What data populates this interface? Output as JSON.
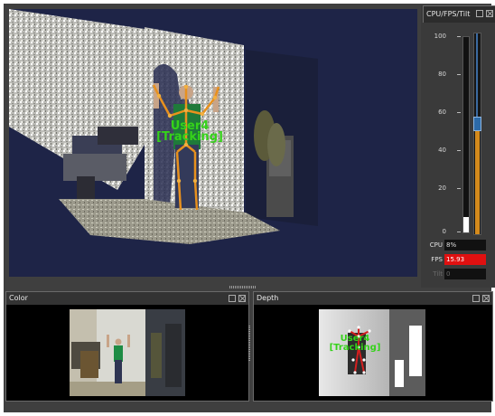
{
  "viewport": {
    "user_label": "User4",
    "tracking_label": "[Tracking]"
  },
  "side_panel": {
    "tab_title": "CPU/FPS/Tilt",
    "scale_ticks": [
      "100",
      "80",
      "60",
      "40",
      "20",
      "0"
    ],
    "cpu_bar_level": 0.08,
    "tilt_level": 0.55,
    "stats": [
      {
        "label": "CPU",
        "value": "8%"
      },
      {
        "label": "FPS",
        "value": "15.93"
      },
      {
        "label": "Tilt",
        "value": "0"
      }
    ]
  },
  "color_panel": {
    "title": "Color"
  },
  "depth_panel": {
    "title": "Depth",
    "user_label": "User4",
    "tracking_label": "[Tracking]"
  },
  "colors": {
    "app_bg": "#3f3f3f",
    "viewport_bg": "#1e2447",
    "skeleton": "#e8911e",
    "user_label": "#35d21a",
    "fps_alert": "#e01010",
    "tilt_fill": "#d48a1c"
  }
}
